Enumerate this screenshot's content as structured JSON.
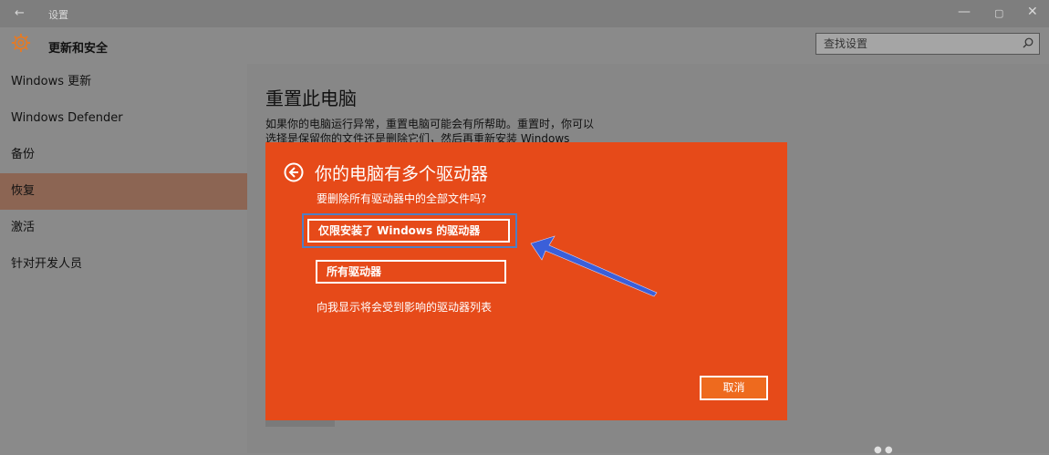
{
  "window": {
    "back_glyph": "←",
    "title": "设置",
    "minimize_glyph": "—",
    "restore_glyph": "▢",
    "close_glyph": "✕"
  },
  "header": {
    "icon": "gear-icon",
    "title": "更新和安全"
  },
  "search": {
    "placeholder": "查找设置",
    "icon": "search-icon"
  },
  "sidebar": {
    "items": [
      {
        "label": "Windows 更新"
      },
      {
        "label": "Windows Defender"
      },
      {
        "label": "备份"
      },
      {
        "label": "恢复"
      },
      {
        "label": "激活"
      },
      {
        "label": "针对开发人员"
      }
    ],
    "active_index": 3
  },
  "content": {
    "title": "重置此电脑",
    "description": "如果你的电脑运行异常，重置电脑可能会有所帮助。重置时，你可以选择是保留你的文件还是删除它们，然后再重新安装 Windows"
  },
  "dialog": {
    "title": "你的电脑有多个驱动器",
    "subtitle": "要删除所有驱动器中的全部文件吗?",
    "option_windows_only": "仅限安装了 Windows 的驱动器",
    "option_all_drives": "所有驱动器",
    "show_list_link": "向我显示将会受到影响的驱动器列表",
    "cancel_label": "取消",
    "background_color": "#e64a19"
  },
  "annotation": {
    "arrow_color": "#3b5fd9"
  }
}
